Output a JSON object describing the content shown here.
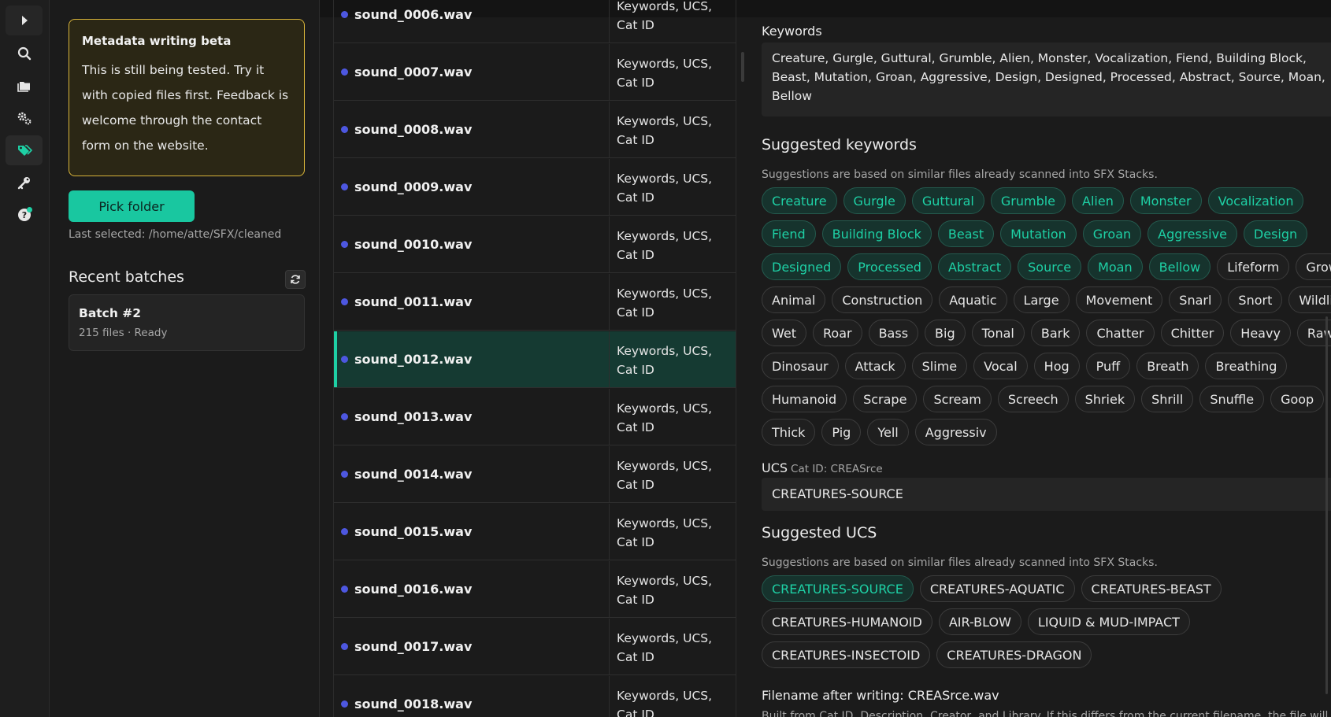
{
  "rail": {
    "icons": [
      "play-icon",
      "search-icon",
      "folder-icon",
      "gears-icon",
      "tags-icon",
      "key-icon",
      "help-icon"
    ]
  },
  "beta": {
    "title": "Metadata writing beta",
    "text": "This is still being tested. Try it with copied files first. Feedback is welcome through the contact form on the website."
  },
  "pick_label": "Pick folder",
  "last_selected": "Last selected: /home/atte/SFX/cleaned",
  "recent": {
    "title": "Recent batches",
    "batch_name": "Batch #2",
    "batch_meta": "215 files · Ready"
  },
  "files": [
    {
      "name": "sound_0006.wav",
      "meta": "Keywords, UCS, Cat ID"
    },
    {
      "name": "sound_0007.wav",
      "meta": "Keywords, UCS, Cat ID"
    },
    {
      "name": "sound_0008.wav",
      "meta": "Keywords, UCS, Cat ID"
    },
    {
      "name": "sound_0009.wav",
      "meta": "Keywords, UCS, Cat ID"
    },
    {
      "name": "sound_0010.wav",
      "meta": "Keywords, UCS, Cat ID"
    },
    {
      "name": "sound_0011.wav",
      "meta": "Keywords, UCS, Cat ID"
    },
    {
      "name": "sound_0012.wav",
      "meta": "Keywords, UCS, Cat ID"
    },
    {
      "name": "sound_0013.wav",
      "meta": "Keywords, UCS, Cat ID"
    },
    {
      "name": "sound_0014.wav",
      "meta": "Keywords, UCS, Cat ID"
    },
    {
      "name": "sound_0015.wav",
      "meta": "Keywords, UCS, Cat ID"
    },
    {
      "name": "sound_0016.wav",
      "meta": "Keywords, UCS, Cat ID"
    },
    {
      "name": "sound_0017.wav",
      "meta": "Keywords, UCS, Cat ID"
    },
    {
      "name": "sound_0018.wav",
      "meta": "Keywords, UCS, Cat ID"
    }
  ],
  "selected_file": "sound_0012.wav",
  "keywords": {
    "label": "Keywords",
    "value": "Creature, Gurgle, Guttural, Grumble, Alien, Monster, Vocalization, Fiend, Building Block, Beast, Mutation, Groan, Aggressive, Design, Designed, Processed, Abstract, Source, Moan, Bellow"
  },
  "suggested_keywords": {
    "title": "Suggested keywords",
    "hint": "Suggestions are based on similar files already scanned into SFX Stacks.",
    "selected": [
      "Creature",
      "Gurgle",
      "Guttural",
      "Grumble",
      "Alien",
      "Monster",
      "Vocalization",
      "Fiend",
      "Building Block",
      "Beast",
      "Mutation",
      "Groan",
      "Aggressive",
      "Design",
      "Designed",
      "Processed",
      "Abstract",
      "Source",
      "Moan",
      "Bellow"
    ],
    "others": [
      "Lifeform",
      "Growl",
      "Animal",
      "Construction",
      "Aquatic",
      "Large",
      "Movement",
      "Snarl",
      "Snort",
      "Wildlife",
      "Wet",
      "Roar",
      "Bass",
      "Big",
      "Tonal",
      "Bark",
      "Chatter",
      "Chitter",
      "Heavy",
      "Raw",
      "Dinosaur",
      "Attack",
      "Slime",
      "Vocal",
      "Hog",
      "Puff",
      "Breath",
      "Breathing",
      "Humanoid",
      "Scrape",
      "Scream",
      "Screech",
      "Shriek",
      "Shrill",
      "Snuffle",
      "Goop",
      "Thick",
      "Pig",
      "Yell",
      "Aggressiv"
    ]
  },
  "ucs": {
    "label": "UCS",
    "cat_id": "Cat ID: CREASrce",
    "value": "CREATURES-SOURCE"
  },
  "suggested_ucs": {
    "title": "Suggested UCS",
    "hint": "Suggestions are based on similar files already scanned into SFX Stacks.",
    "items": [
      {
        "label": "CREATURES-SOURCE",
        "selected": true
      },
      {
        "label": "CREATURES-AQUATIC",
        "selected": false
      },
      {
        "label": "CREATURES-BEAST",
        "selected": false
      },
      {
        "label": "CREATURES-HUMANOID",
        "selected": false
      },
      {
        "label": "AIR-BLOW",
        "selected": false
      },
      {
        "label": "LIQUID & MUD-IMPACT",
        "selected": false
      },
      {
        "label": "CREATURES-INSECTOID",
        "selected": false
      },
      {
        "label": "CREATURES-DRAGON",
        "selected": false
      }
    ]
  },
  "filename_after": "Filename after writing: CREASrce.wav",
  "filename_hint": "Built from Cat ID, Description, Creator, and Library. If this differs from the current filename, the file will be",
  "colors": {
    "accent": "#1ed0a5",
    "dot": "#4d57e0",
    "beta_border": "#d8b43a"
  }
}
